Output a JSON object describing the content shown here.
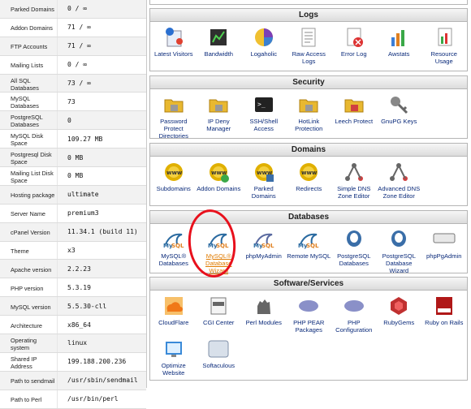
{
  "stats": [
    {
      "label": "Parked Domains",
      "value": "0 / ∞"
    },
    {
      "label": "Addon Domains",
      "value": "71 / ∞"
    },
    {
      "label": "FTP Accounts",
      "value": "71 / ∞"
    },
    {
      "label": "Mailing Lists",
      "value": "0 / ∞"
    },
    {
      "label": "All SQL Databases",
      "value": "73 / ∞"
    },
    {
      "label": "MySQL Databases",
      "value": "73"
    },
    {
      "label": "PostgreSQL Databases",
      "value": "0"
    },
    {
      "label": "MySQL Disk Space",
      "value": "109.27 MB"
    },
    {
      "label": "Postgresql Disk Space",
      "value": "0 MB"
    },
    {
      "label": "Mailing List Disk Space",
      "value": "0 MB"
    },
    {
      "label": "Hosting package",
      "value": "ultimate"
    },
    {
      "label": "Server Name",
      "value": "premium3"
    },
    {
      "label": "cPanel Version",
      "value": "11.34.1 (build 11)"
    },
    {
      "label": "Theme",
      "value": "x3"
    },
    {
      "label": "Apache version",
      "value": "2.2.23"
    },
    {
      "label": "PHP version",
      "value": "5.3.19"
    },
    {
      "label": "MySQL version",
      "value": "5.5.30-cll"
    },
    {
      "label": "Architecture",
      "value": "x86_64"
    },
    {
      "label": "Operating system",
      "value": "linux"
    },
    {
      "label": "Shared IP Address",
      "value": "199.188.200.236"
    },
    {
      "label": "Path to sendmail",
      "value": "/usr/sbin/sendmail"
    },
    {
      "label": "Path to Perl",
      "value": "/usr/bin/perl"
    }
  ],
  "sections": {
    "logs": {
      "title": "Logs",
      "items": [
        {
          "label": "Latest Visitors",
          "icon": "latest-visitors-icon"
        },
        {
          "label": "Bandwidth",
          "icon": "bandwidth-icon"
        },
        {
          "label": "Logaholic",
          "icon": "logaholic-icon"
        },
        {
          "label": "Raw Access Logs",
          "icon": "raw-access-logs-icon"
        },
        {
          "label": "Error Log",
          "icon": "error-log-icon"
        },
        {
          "label": "Awstats",
          "icon": "awstats-icon"
        },
        {
          "label": "Resource Usage",
          "icon": "resource-usage-icon"
        }
      ]
    },
    "security": {
      "title": "Security",
      "items": [
        {
          "label": "Password Protect Directories",
          "icon": "password-protect-icon"
        },
        {
          "label": "IP Deny Manager",
          "icon": "ip-deny-icon"
        },
        {
          "label": "SSH/Shell Access",
          "icon": "ssh-shell-icon"
        },
        {
          "label": "HotLink Protection",
          "icon": "hotlink-icon"
        },
        {
          "label": "Leech Protect",
          "icon": "leech-protect-icon"
        },
        {
          "label": "GnuPG Keys",
          "icon": "gnupg-keys-icon"
        }
      ]
    },
    "domains": {
      "title": "Domains",
      "items": [
        {
          "label": "Subdomains",
          "icon": "subdomains-icon"
        },
        {
          "label": "Addon Domains",
          "icon": "addon-domains-icon"
        },
        {
          "label": "Parked Domains",
          "icon": "parked-domains-icon"
        },
        {
          "label": "Redirects",
          "icon": "redirects-icon"
        },
        {
          "label": "Simple DNS Zone Editor",
          "icon": "simple-dns-icon"
        },
        {
          "label": "Advanced DNS Zone Editor",
          "icon": "advanced-dns-icon"
        }
      ]
    },
    "databases": {
      "title": "Databases",
      "items": [
        {
          "label": "MySQL® Databases",
          "icon": "mysql-databases-icon"
        },
        {
          "label": "MySQL® Database Wizard",
          "icon": "mysql-wizard-icon"
        },
        {
          "label": "phpMyAdmin",
          "icon": "phpmyadmin-icon"
        },
        {
          "label": "Remote MySQL",
          "icon": "remote-mysql-icon"
        },
        {
          "label": "PostgreSQL Databases",
          "icon": "postgresql-databases-icon"
        },
        {
          "label": "PostgreSQL Database Wizard",
          "icon": "postgresql-wizard-icon"
        },
        {
          "label": "phpPgAdmin",
          "icon": "phppgadmin-icon"
        }
      ]
    },
    "software": {
      "title": "Software/Services",
      "items": [
        {
          "label": "CloudFlare",
          "icon": "cloudflare-icon"
        },
        {
          "label": "CGI Center",
          "icon": "cgi-center-icon"
        },
        {
          "label": "Perl Modules",
          "icon": "perl-modules-icon"
        },
        {
          "label": "PHP PEAR Packages",
          "icon": "php-pear-icon"
        },
        {
          "label": "PHP Configuration",
          "icon": "php-configuration-icon"
        },
        {
          "label": "RubyGems",
          "icon": "rubygems-icon"
        },
        {
          "label": "Ruby on Rails",
          "icon": "ruby-on-rails-icon"
        },
        {
          "label": "Optimize Website",
          "icon": "optimize-website-icon"
        },
        {
          "label": "Softaculous",
          "icon": "softaculous-icon"
        }
      ]
    }
  }
}
